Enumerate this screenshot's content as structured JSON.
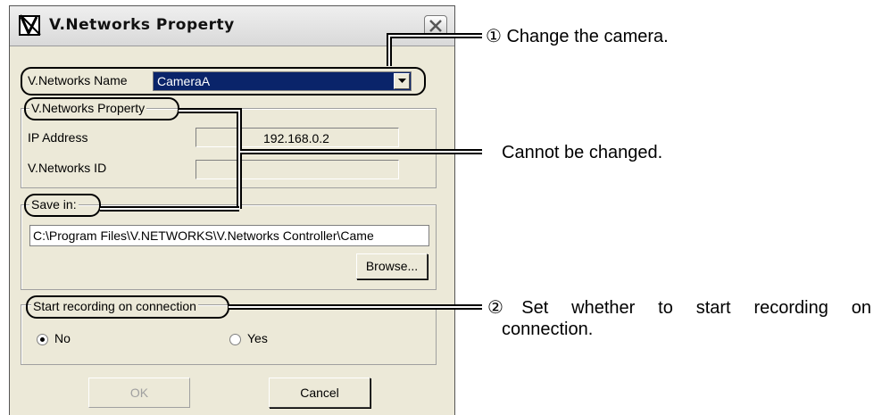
{
  "window": {
    "title": "V.Networks Property",
    "icon": "v-networks-app-icon",
    "close_icon": "close-icon"
  },
  "name_row": {
    "label": "V.Networks Name",
    "selected": "CameraA"
  },
  "property_group": {
    "label": "V.Networks Property",
    "ip_label": "IP Address",
    "ip_value": "192.168.0.2",
    "id_label": "V.Networks ID",
    "id_value": ""
  },
  "save_group": {
    "label": "Save in:",
    "path": "C:\\Program Files\\V.NETWORKS\\V.Networks Controller\\Came",
    "browse_label": "Browse..."
  },
  "recording_group": {
    "label": "Start recording on connection",
    "options": [
      {
        "label": "No",
        "selected": true
      },
      {
        "label": "Yes",
        "selected": false
      }
    ]
  },
  "buttons": {
    "ok_label": "OK",
    "cancel_label": "Cancel"
  },
  "annotations": {
    "camera": "① Change the camera.",
    "cannot_change": "Cannot be changed.",
    "recording_line1": "②Set whether to start recording on",
    "recording_line2": "connection."
  }
}
